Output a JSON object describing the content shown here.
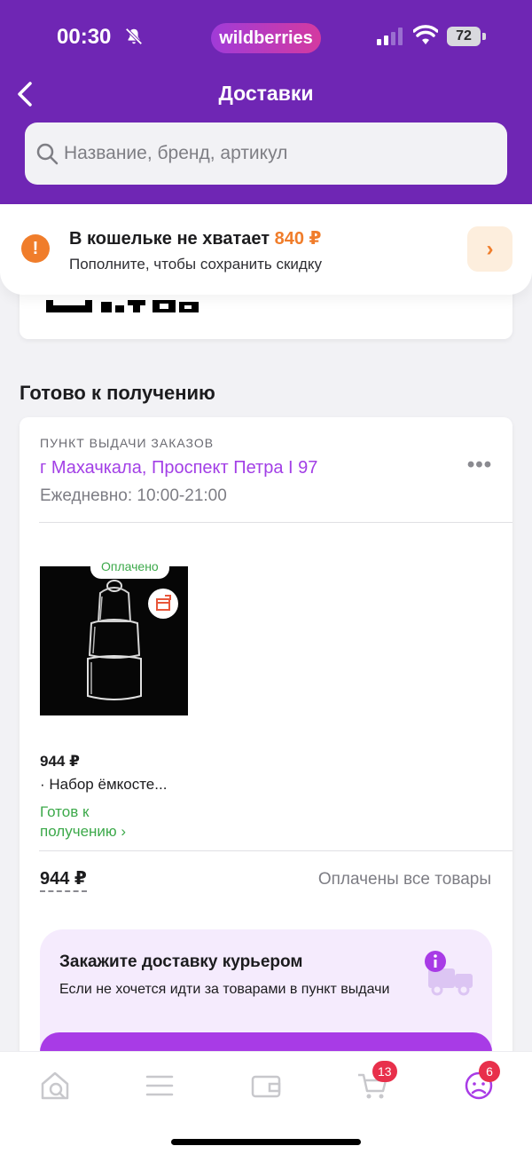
{
  "status_bar": {
    "time": "00:30",
    "brand": "wildberries",
    "battery": "72"
  },
  "header": {
    "title": "Доставки",
    "search_placeholder": "Название, бренд, артикул"
  },
  "wallet_banner": {
    "title": "В кошельке не хватает",
    "amount": "840 ₽",
    "subtitle": "Пополните, чтобы сохранить скидку"
  },
  "section": {
    "title": "Готово к получению"
  },
  "order": {
    "pickup_label": "ПУНКТ ВЫДАЧИ ЗАКАЗОВ",
    "address": "г Махачкала, Проспект Петра I 97",
    "hours": "Ежедневно: 10:00-21:00",
    "item": {
      "paid_badge": "Оплачено",
      "price": "944 ₽",
      "name": "· Набор ёмкосте...",
      "status": "Готов к получению ›"
    },
    "total_price": "944 ₽",
    "total_status": "Оплачены все товары"
  },
  "courier": {
    "title": "Закажите доставку курьером",
    "text": "Если не хочется идти за товарами в пункт выдачи"
  },
  "bottom_nav": {
    "cart_badge": "13",
    "profile_badge": "6"
  },
  "colors": {
    "brand_purple": "#6f26b4",
    "accent_purple": "#a23fe6",
    "warning_orange": "#f07d2b",
    "success_green": "#3ca94a",
    "badge_red": "#e8304b"
  }
}
